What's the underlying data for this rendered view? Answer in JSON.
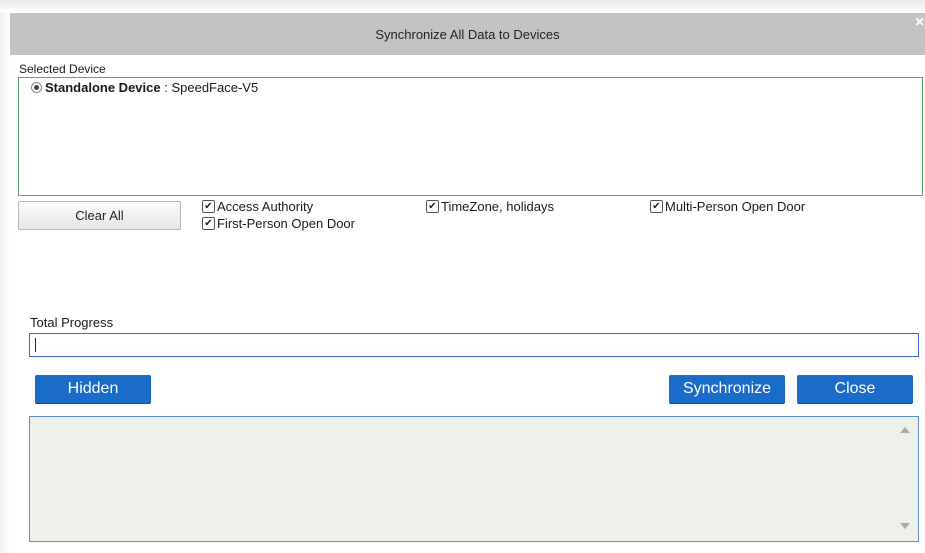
{
  "dialog": {
    "title": "Synchronize All Data to Devices",
    "close_glyph": "×"
  },
  "selected_device": {
    "label": "Selected Device",
    "device_name": "Standalone Device",
    "device_separator": " : ",
    "device_model": "SpeedFace-V5"
  },
  "options": {
    "clear_all_label": "Clear All",
    "check_glyph": "✔",
    "items": [
      {
        "label": "Access Authority",
        "checked": true
      },
      {
        "label": "TimeZone, holidays",
        "checked": true
      },
      {
        "label": "Multi-Person Open Door",
        "checked": true
      },
      {
        "label": "First-Person Open Door",
        "checked": true
      }
    ]
  },
  "progress": {
    "label": "Total Progress",
    "value": 0
  },
  "buttons": {
    "hidden_label": "Hidden",
    "synchronize_label": "Synchronize",
    "close_label": "Close"
  },
  "colors": {
    "accent": "#1a6cc8",
    "titlebar": "#c3c3c3",
    "device_border": "#5aa85a",
    "log_bg": "#eef0ea"
  },
  "icons": {
    "close": "close-icon",
    "radio": "radio-selected-icon",
    "checkbox": "checkbox-checked-icon",
    "scroll_up": "scroll-up-arrow-icon",
    "scroll_down": "scroll-down-arrow-icon"
  }
}
